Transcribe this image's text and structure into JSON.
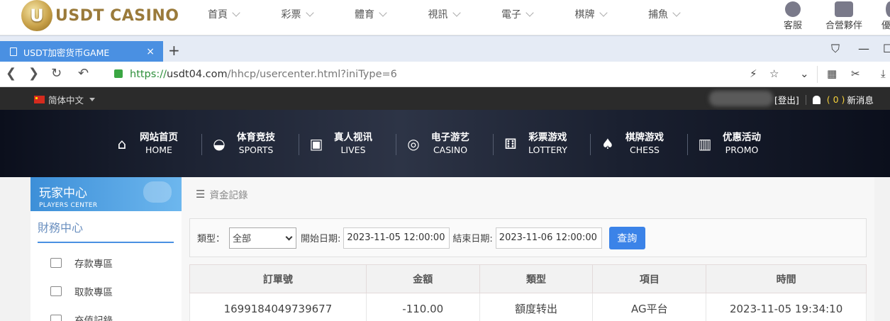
{
  "site_header": {
    "logo_text": "USDT CASINO",
    "logo_badge": "U",
    "nav": [
      "首頁",
      "彩票",
      "體育",
      "視訊",
      "電子",
      "棋牌",
      "捕魚"
    ],
    "service": "客服",
    "partner": "合營夥伴",
    "cut_right": "優"
  },
  "browser": {
    "tab_title": "USDT加密货币GAME",
    "tab_close": "×",
    "new_tab": "+",
    "url_scheme": "https://",
    "url_host": "usdt04.com",
    "url_path": "/hhcp/usercenter.html?iniType=6"
  },
  "topbar": {
    "language": "简体中文",
    "logout": "[登出]",
    "msg_count": "( 0 )",
    "msg_label": "新消息"
  },
  "main_nav": [
    {
      "zh": "网站首页",
      "en": "HOME",
      "icon": "home-icon"
    },
    {
      "zh": "体育竞技",
      "en": "SPORTS",
      "icon": "ball-icon"
    },
    {
      "zh": "真人视讯",
      "en": "LIVES",
      "icon": "cards-icon"
    },
    {
      "zh": "电子游艺",
      "en": "CASINO",
      "icon": "roulette-icon"
    },
    {
      "zh": "彩票游戏",
      "en": "LOTTERY",
      "icon": "dice-icon"
    },
    {
      "zh": "棋牌游戏",
      "en": "CHESS",
      "icon": "spade-icon"
    },
    {
      "zh": "优惠活动",
      "en": "PROMO",
      "icon": "gift-icon"
    }
  ],
  "sidebar": {
    "title": "玩家中心",
    "subtitle": "PLAYERS CENTER",
    "section": "財務中心",
    "items": [
      "存款專區",
      "取款專區",
      "充值記錄"
    ]
  },
  "content": {
    "breadcrumb": "資金記錄",
    "filter": {
      "type_label": "類型：",
      "type_value": "全部",
      "start_label": "開始日期:",
      "start_value": "2023-11-05 12:00:00",
      "end_label": "結束日期:",
      "end_value": "2023-11-06 12:00:00",
      "query": "查詢"
    },
    "table": {
      "headers": [
        "訂單號",
        "金額",
        "類型",
        "項目",
        "時間"
      ],
      "rows": [
        [
          "1699184049739677",
          "-110.00",
          "額度转出",
          "AG平台",
          "2023-11-05 19:34:10"
        ]
      ]
    }
  }
}
